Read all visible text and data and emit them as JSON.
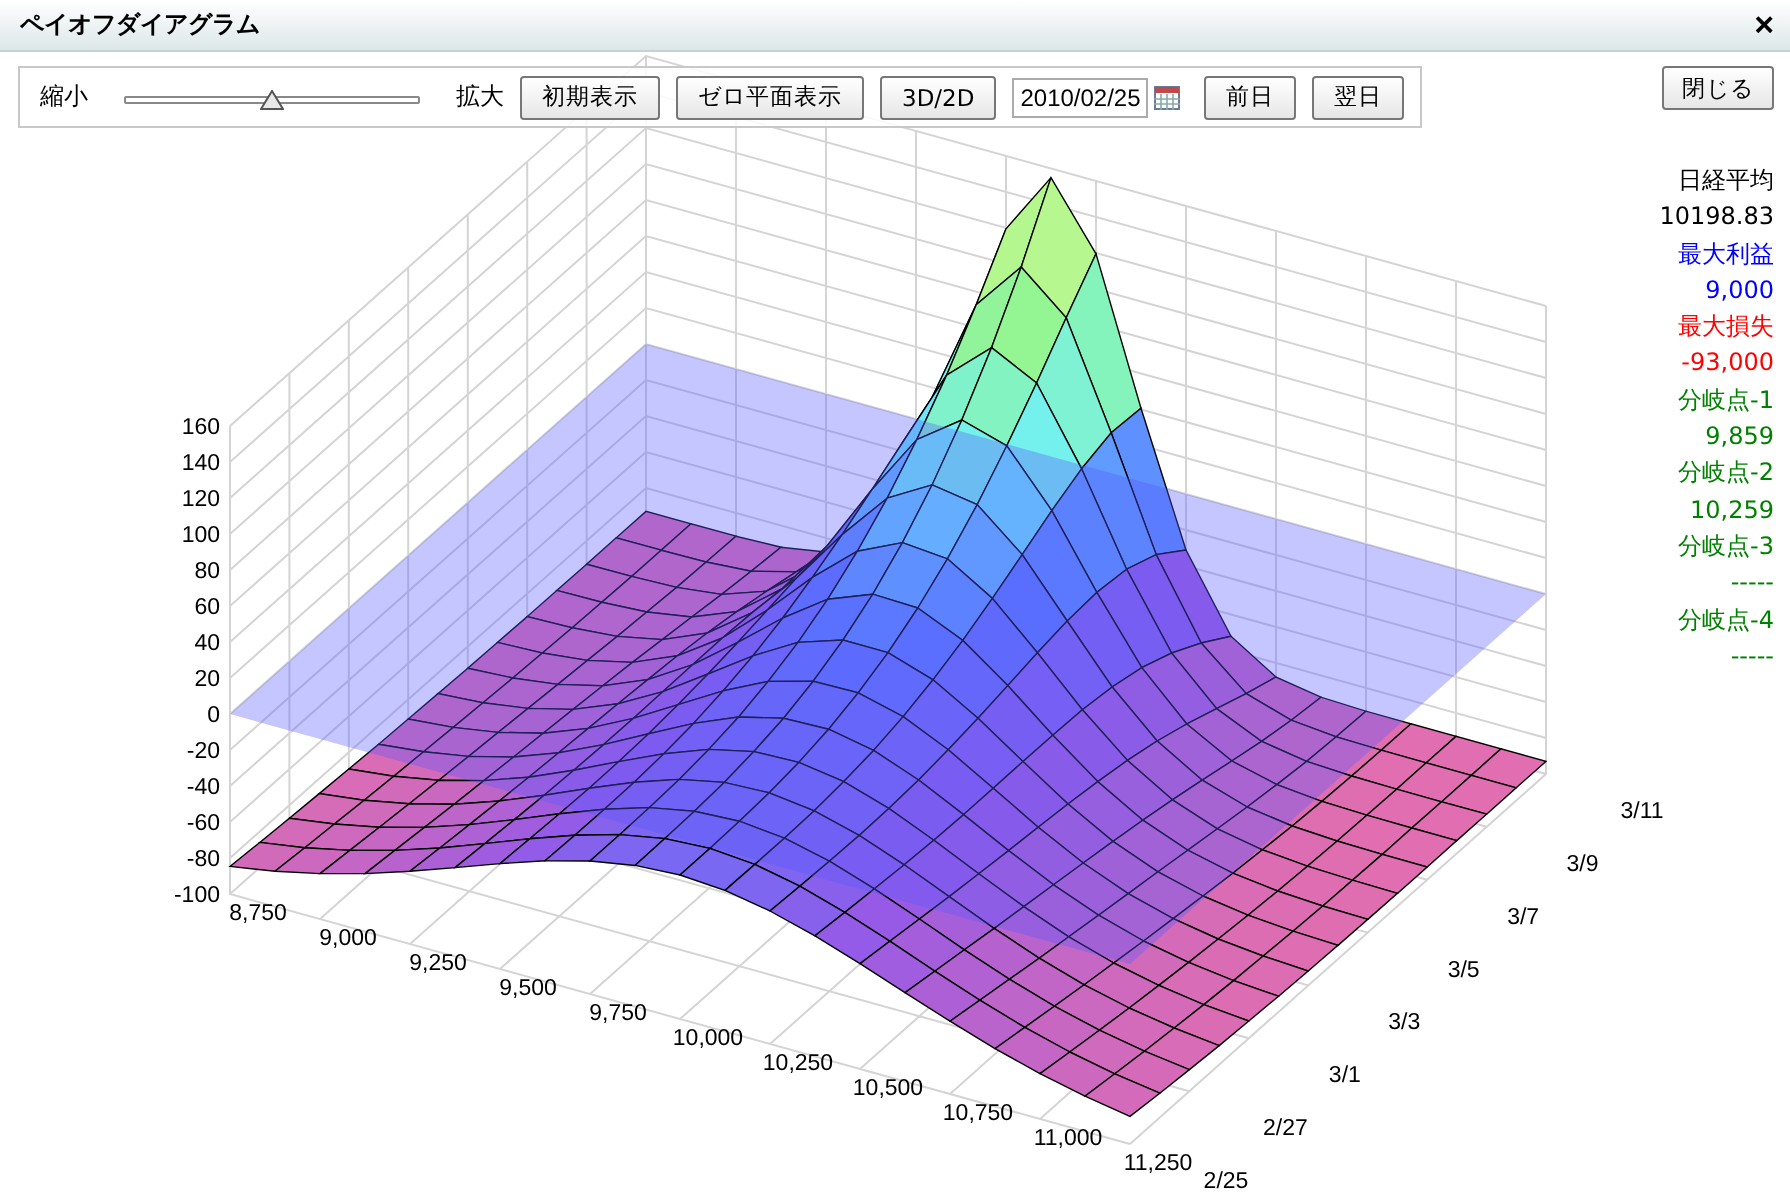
{
  "window": {
    "title": "ペイオフダイアグラム",
    "close": "×"
  },
  "toolbar": {
    "zoom_out": "縮小",
    "zoom_in": "拡大",
    "zoom": {
      "level": 0.5
    },
    "buttons": [
      "初期表示",
      "ゼロ平面表示",
      "3D/2D"
    ],
    "date": {
      "value": "2010/02/25"
    },
    "nav_buttons": [
      "前日",
      "翌日"
    ]
  },
  "close_button": "閉じる",
  "summary": [
    {
      "label": "日経平均",
      "value": "10198.83",
      "kind": "index"
    },
    {
      "label": "最大利益",
      "value": "9,000",
      "kind": "profit"
    },
    {
      "label": "最大損失",
      "value": "-93,000",
      "kind": "loss"
    },
    {
      "label": "分岐点-1",
      "value": "9,859",
      "kind": "breakeven"
    },
    {
      "label": "分岐点-2",
      "value": "10,259",
      "kind": "breakeven"
    },
    {
      "label": "分岐点-3",
      "value": "-----",
      "kind": "breakeven"
    },
    {
      "label": "分岐点-4",
      "value": "-----",
      "kind": "breakeven"
    }
  ],
  "chart": {
    "z_ticks": [
      "160",
      "140",
      "120",
      "100",
      "80",
      "60",
      "40",
      "20",
      "0",
      "-20",
      "-40",
      "-60",
      "-80",
      "-100"
    ],
    "x_ticks": [
      "8,750",
      "9,000",
      "9,250",
      "9,500",
      "9,750",
      "10,000",
      "10,250",
      "10,500",
      "10,750",
      "11,000",
      "11,250"
    ],
    "y_ticks": [
      "2/25",
      "2/27",
      "3/1",
      "3/3",
      "3/5",
      "3/7",
      "3/9",
      "3/11"
    ]
  }
}
